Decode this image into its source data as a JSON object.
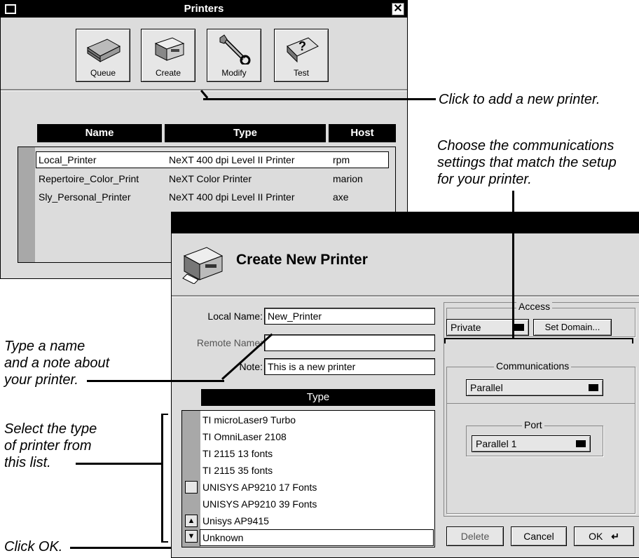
{
  "printers_window": {
    "title": "Printers",
    "close_glyph": "✕",
    "toolbar": {
      "queue_label": "Queue",
      "create_label": "Create",
      "modify_label": "Modify",
      "test_label": "Test"
    },
    "columns": [
      "Name",
      "Type",
      "Host"
    ],
    "rows": [
      {
        "name": "Local_Printer",
        "type": "NeXT 400 dpi Level II Printer",
        "host": "rpm"
      },
      {
        "name": "Repertoire_Color_Print",
        "type": "NeXT Color Printer",
        "host": "marion"
      },
      {
        "name": "Sly_Personal_Printer",
        "type": "NeXT 400 dpi Level II Printer",
        "host": "axe"
      }
    ]
  },
  "create_window": {
    "title": "Create New Printer",
    "local_name_label": "Local Name:",
    "local_name_value": "New_Printer",
    "remote_name_label": "Remote Name:",
    "remote_name_value": "",
    "note_label": "Note:",
    "note_value": "This is a new printer",
    "type_header": "Type",
    "type_list": [
      "TI microLaser9 Turbo",
      "TI OmniLaser 2108",
      "TI 2115 13 fonts",
      "TI 2115 35 fonts",
      "UNISYS AP9210 17 Fonts",
      "UNISYS AP9210 39 Fonts",
      "Unisys AP9415",
      "Unknown"
    ],
    "access": {
      "title": "Access",
      "selected": "Private",
      "set_domain_label": "Set Domain..."
    },
    "communications": {
      "title": "Communications",
      "selected": "Parallel",
      "port_title": "Port",
      "port_selected": "Parallel 1"
    },
    "delete_label": "Delete",
    "cancel_label": "Cancel",
    "ok_label": "OK",
    "return_glyph": "↵"
  },
  "callouts": {
    "add_printer": "Click to add a new printer.",
    "comm_line1": "Choose the communications",
    "comm_line2": "settings that match the setup",
    "comm_line3": "for your printer.",
    "name_line1": "Type a name",
    "name_line2": "and a note about",
    "name_line3": "your printer.",
    "type_line1": "Select the type",
    "type_line2": "of printer from",
    "type_line3": "this list.",
    "ok": "Click OK."
  }
}
